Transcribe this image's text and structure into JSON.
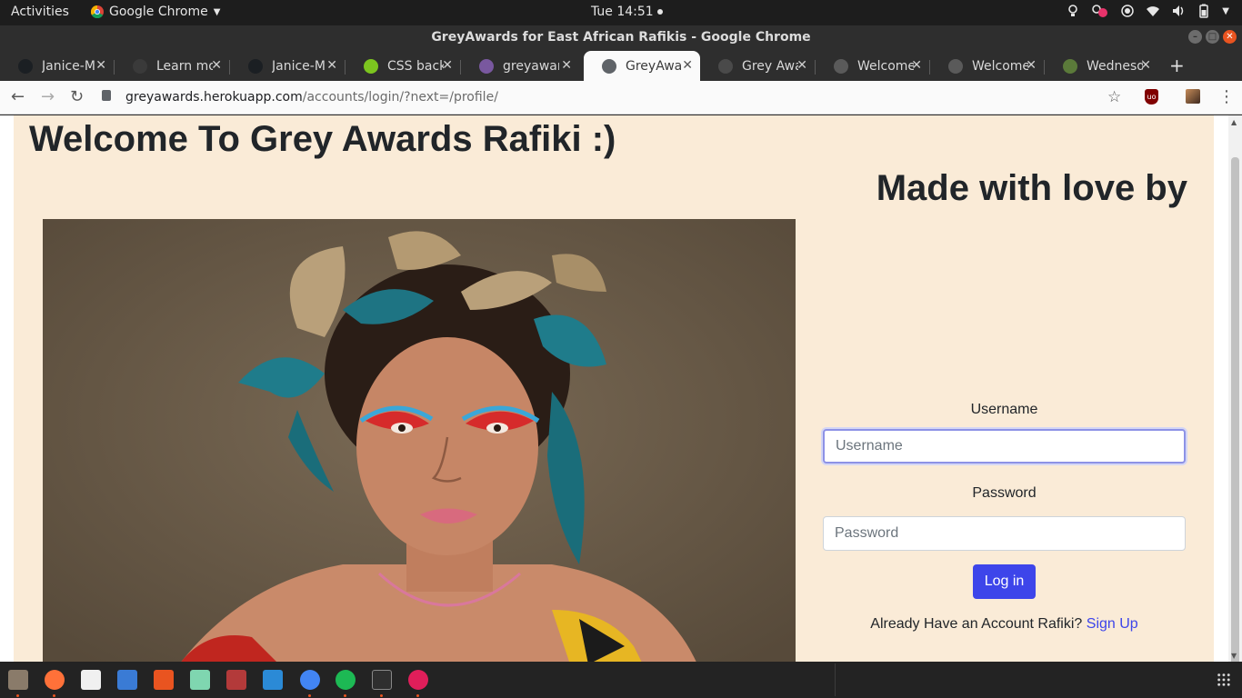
{
  "topbar": {
    "activities": "Activities",
    "app_name": "Google Chrome",
    "clock": "Tue 14:51"
  },
  "window": {
    "title": "GreyAwards for East African Rafikis - Google Chrome"
  },
  "tabs": [
    {
      "label": "Janice-M",
      "icon": "github-icon",
      "color": "#1b1f23",
      "active": false
    },
    {
      "label": "Learn mo",
      "icon": "app-icon",
      "color": "#3a3a3a",
      "active": false
    },
    {
      "label": "Janice-M",
      "icon": "github-icon",
      "color": "#1b1f23",
      "active": false
    },
    {
      "label": "CSS back",
      "icon": "css-icon",
      "color": "#7cc51f",
      "active": false
    },
    {
      "label": "greyawar",
      "icon": "heroku-icon",
      "color": "#79589f",
      "active": false
    },
    {
      "label": "GreyAwa",
      "icon": "globe-icon",
      "color": "#5f6368",
      "active": true
    },
    {
      "label": "Grey Awa",
      "icon": "w3-icon",
      "color": "#4a4a4a",
      "active": false
    },
    {
      "label": "Welcome",
      "icon": "globe-icon",
      "color": "#5a5a5a",
      "active": false
    },
    {
      "label": "Welcome",
      "icon": "globe-icon",
      "color": "#5a5a5a",
      "active": false
    },
    {
      "label": "Wednesd",
      "icon": "leaf-icon",
      "color": "#5b7a3a",
      "active": false
    }
  ],
  "address_bar": {
    "domain": "greyawards.herokuapp.com",
    "path": "/accounts/login/?next=/profile/"
  },
  "page": {
    "welcome_heading": "Welcome To Grey Awards Rafiki :)",
    "made_with_love": "Made with love by",
    "form": {
      "username_label": "Username",
      "username_placeholder": "Username",
      "password_label": "Password",
      "password_placeholder": "Password",
      "login_button": "Log in",
      "account_prompt": "Already Have an Account Rafiki?",
      "signup_link": "Sign Up"
    }
  },
  "colors": {
    "page_background": "#faebd7",
    "accent_button": "#3d45ea"
  },
  "taskbar_apps": [
    "files-icon",
    "firefox-icon",
    "tux-icon",
    "document-icon",
    "software-store-icon",
    "sheets-icon",
    "toolbox-icon",
    "vscode-icon",
    "chrome-icon",
    "spotify-icon",
    "terminal-icon",
    "slack-icon"
  ]
}
